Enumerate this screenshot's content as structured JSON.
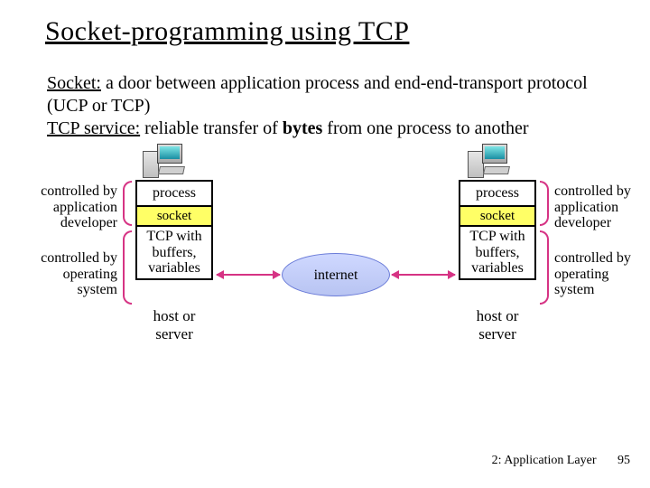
{
  "title": "Socket-programming using TCP",
  "intro": {
    "socket_label": "Socket:",
    "socket_text": " a door between application process and end-end-transport protocol (UCP or TCP)",
    "tcp_label": "TCP service:",
    "tcp_text_a": " reliable transfer of ",
    "tcp_bytes": "bytes",
    "tcp_text_b": " from one process to another"
  },
  "labels": {
    "app_dev": "controlled by application developer",
    "os": "controlled by operating system",
    "process": "process",
    "socket": "socket",
    "tcp": "TCP with buffers, variables",
    "host": "host or server",
    "internet": "internet"
  },
  "footer": {
    "chapter": "2: Application Layer",
    "page": "95"
  }
}
